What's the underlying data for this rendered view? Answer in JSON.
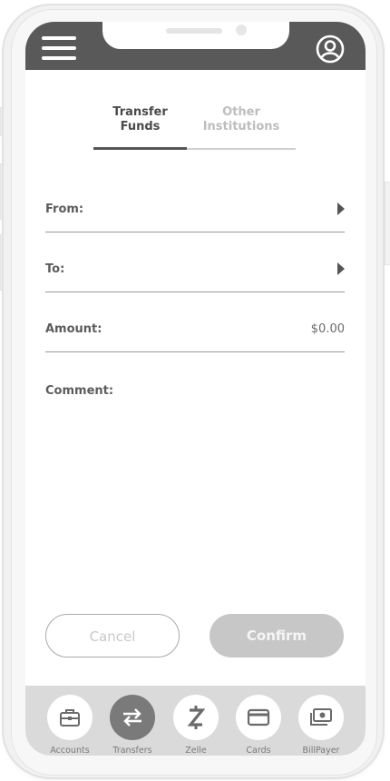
{
  "tabs": [
    {
      "label": "Transfer\nFunds",
      "line1": "Transfer",
      "line2": "Funds"
    },
    {
      "line1": "Other",
      "line2": "Institutions"
    }
  ],
  "form": {
    "from_label": "From:",
    "to_label": "To:",
    "amount_label": "Amount:",
    "amount_value": "$0.00",
    "comment_label": "Comment:"
  },
  "buttons": {
    "cancel": "Cancel",
    "confirm": "Confirm"
  },
  "nav": [
    {
      "label": "Accounts",
      "icon": "briefcase-icon"
    },
    {
      "label": "Transfers",
      "icon": "transfer-arrows-icon",
      "active": true
    },
    {
      "label": "Zelle",
      "icon": "zelle-icon"
    },
    {
      "label": "Cards",
      "icon": "card-icon"
    },
    {
      "label": "BillPayer",
      "icon": "bill-icon"
    }
  ],
  "colors": {
    "header": "#595959",
    "accent_active": "#555555",
    "confirm_disabled": "#c7c7c7",
    "nav_background": "#dadada"
  }
}
